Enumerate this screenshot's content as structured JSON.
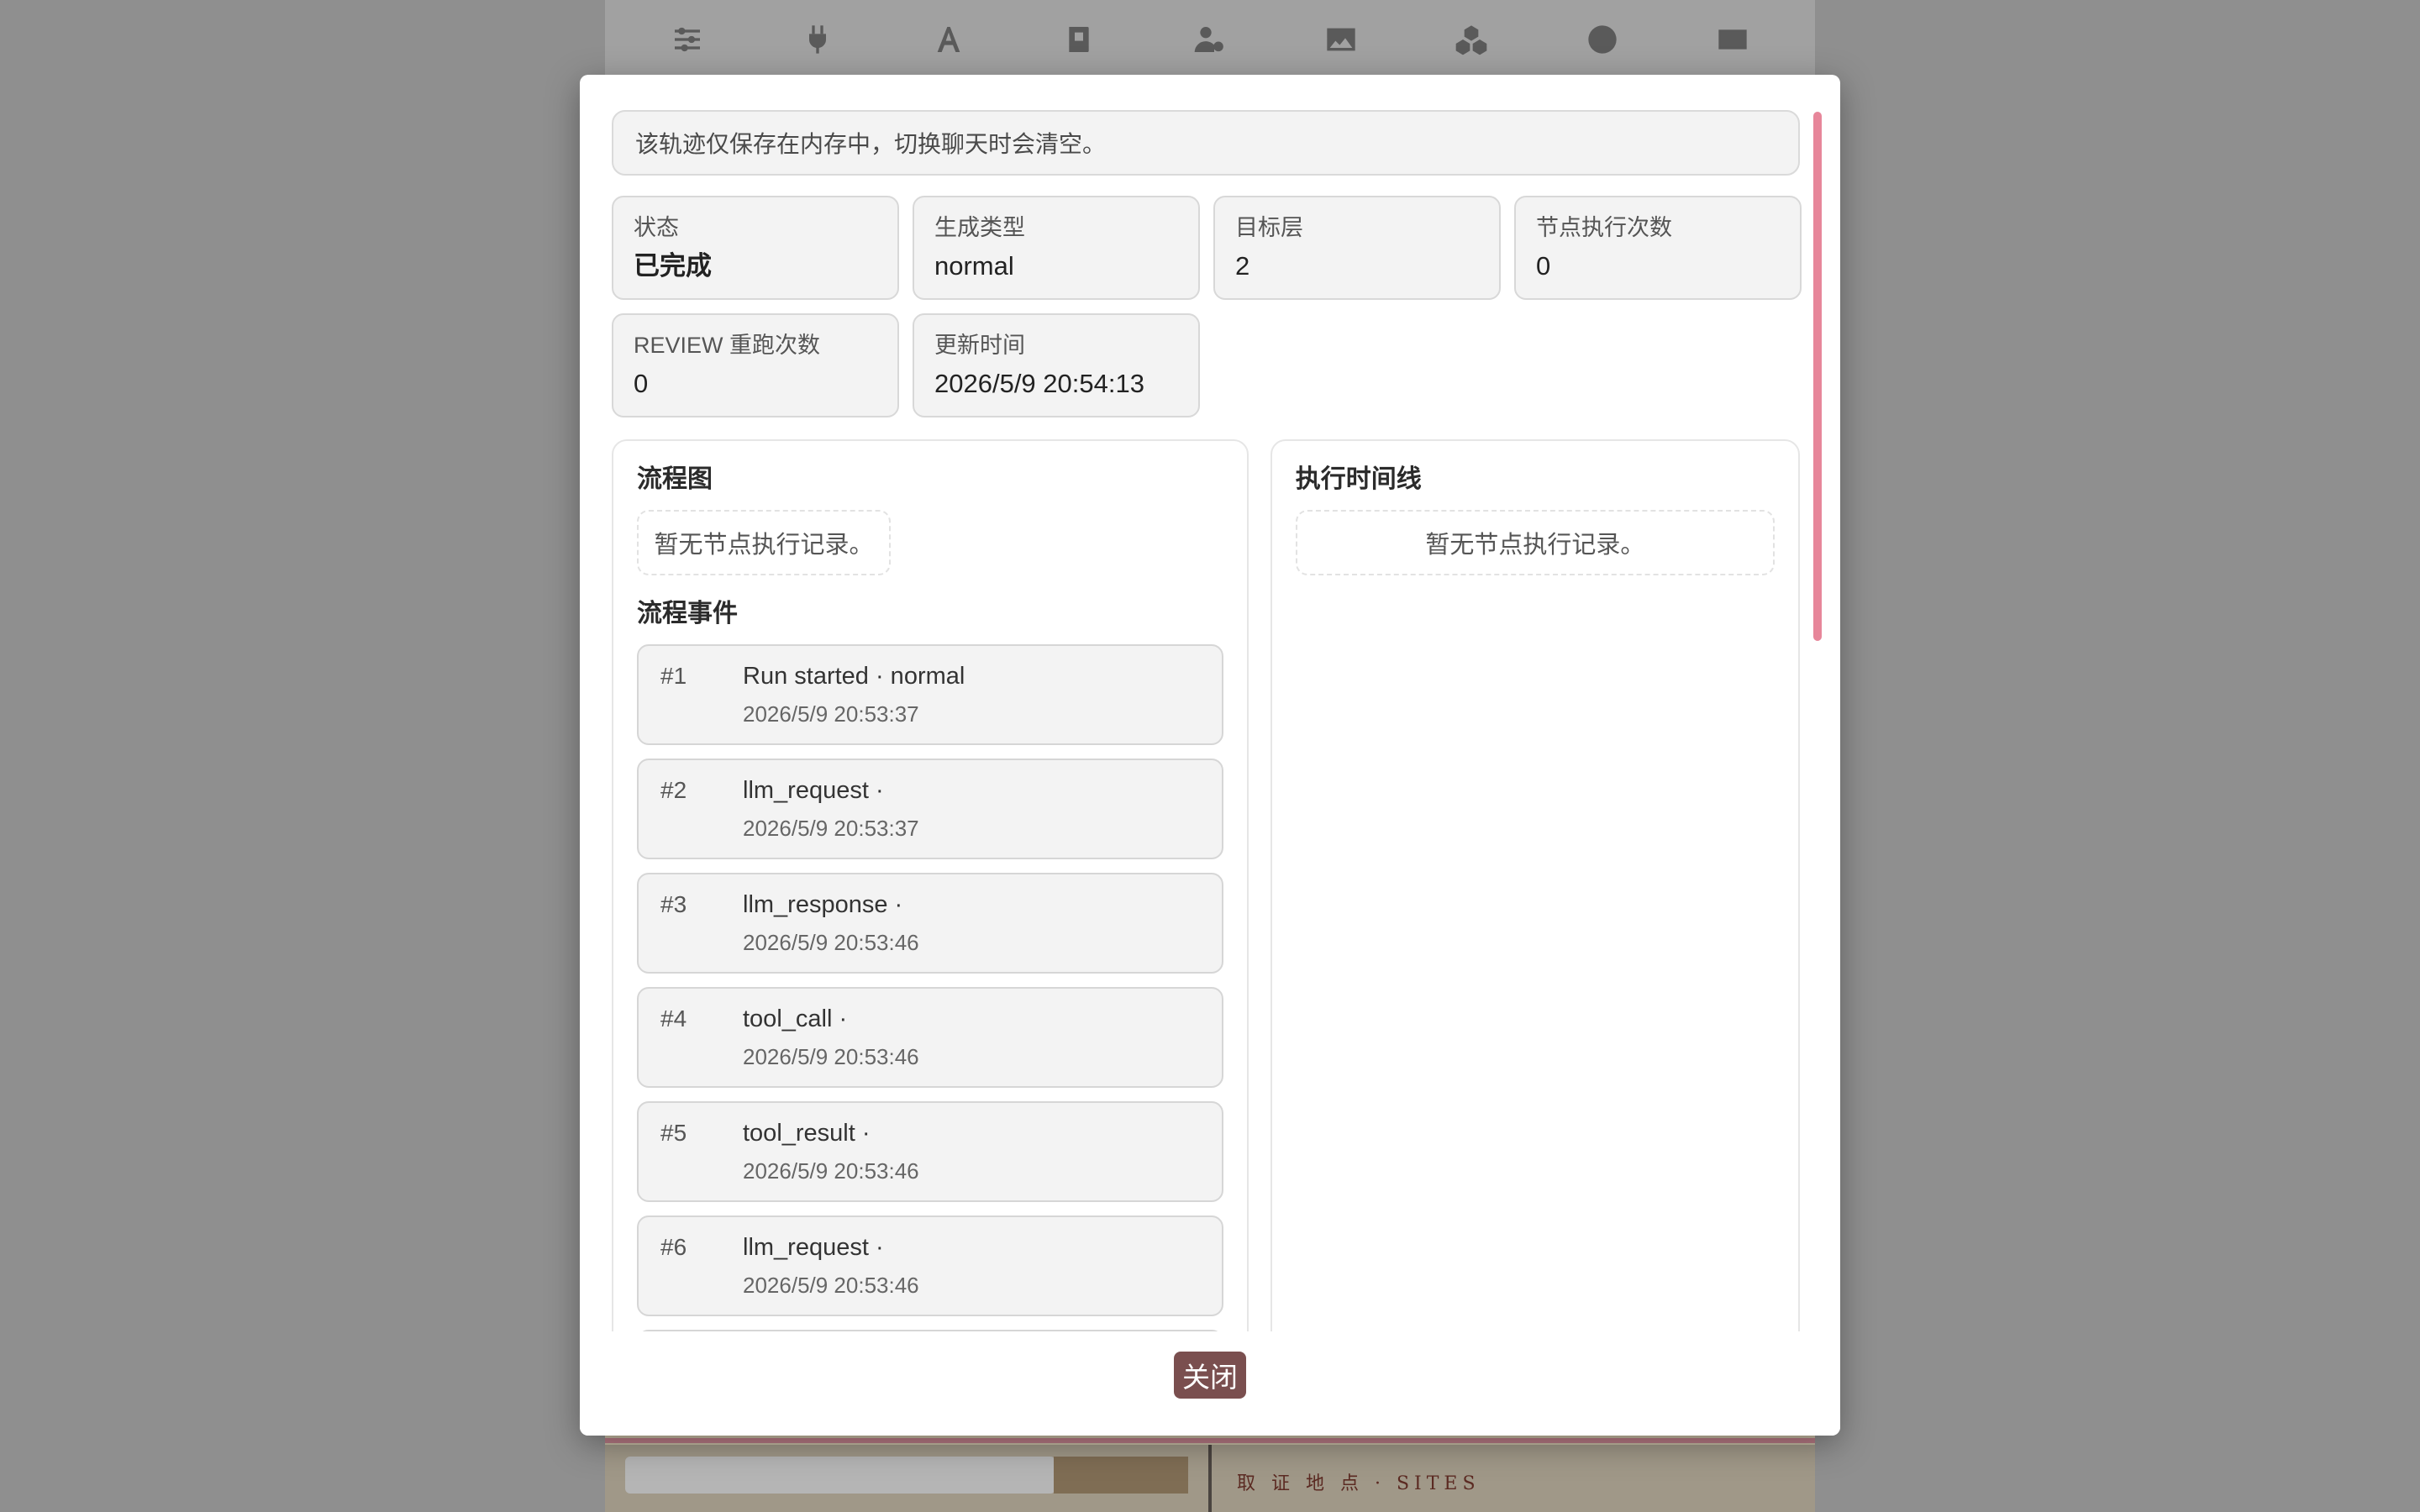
{
  "background": {
    "toolbar_icons": [
      "sliders-icon",
      "plug-icon",
      "font-icon",
      "book-icon",
      "user-gear-icon",
      "image-icon",
      "cubes-icon",
      "smile-icon",
      "id-card-icon"
    ],
    "sites_label": "取 证 地 点 · SITES"
  },
  "modal": {
    "notice": "该轨迹仅保存在内存中，切换聊天时会清空。",
    "stats": [
      {
        "label": "状态",
        "value": "已完成"
      },
      {
        "label": "生成类型",
        "value": "normal"
      },
      {
        "label": "目标层",
        "value": "2"
      },
      {
        "label": "节点执行次数",
        "value": "0"
      },
      {
        "label": "REVIEW 重跑次数",
        "value": "0"
      },
      {
        "label": "更新时间",
        "value": "2026/5/9 20:54:13"
      }
    ],
    "flowchart": {
      "title": "流程图",
      "empty": "暂无节点执行记录。"
    },
    "events": {
      "title": "流程事件",
      "items": [
        {
          "index": "#1",
          "name": "Run started · normal",
          "time": "2026/5/9 20:53:37"
        },
        {
          "index": "#2",
          "name": "llm_request ·",
          "time": "2026/5/9 20:53:37"
        },
        {
          "index": "#3",
          "name": "llm_response ·",
          "time": "2026/5/9 20:53:46"
        },
        {
          "index": "#4",
          "name": "tool_call ·",
          "time": "2026/5/9 20:53:46"
        },
        {
          "index": "#5",
          "name": "tool_result ·",
          "time": "2026/5/9 20:53:46"
        },
        {
          "index": "#6",
          "name": "llm_request ·",
          "time": "2026/5/9 20:53:46"
        },
        {
          "index": "",
          "name": "",
          "time": ""
        }
      ]
    },
    "timeline": {
      "title": "执行时间线",
      "empty": "暂无节点执行记录。"
    },
    "close_label": "关闭"
  }
}
